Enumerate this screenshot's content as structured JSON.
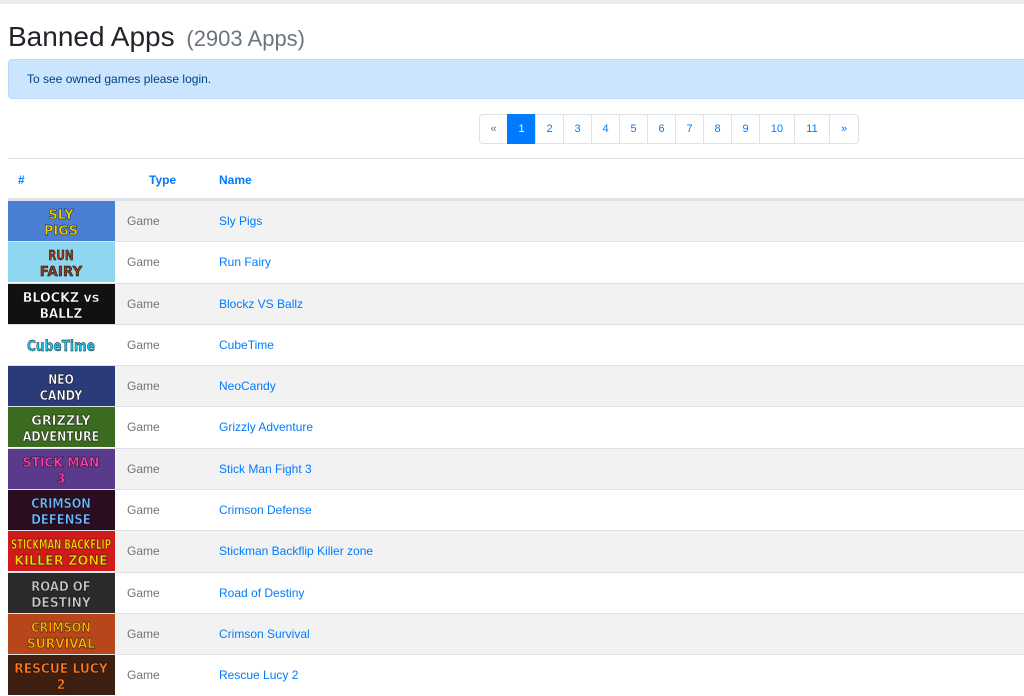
{
  "header": {
    "title": "Banned Apps",
    "count": "(2903 Apps)"
  },
  "alert": {
    "text": "To see owned games please login."
  },
  "pagination": {
    "prev": "«",
    "pages": [
      "1",
      "2",
      "3",
      "4",
      "5",
      "6",
      "7",
      "8",
      "9",
      "10",
      "11"
    ],
    "next": "»",
    "active": "1"
  },
  "table": {
    "columns": {
      "index": "#",
      "type": "Type",
      "name": "Name"
    },
    "rows": [
      {
        "type": "Game",
        "name": "Sly Pigs",
        "thumb_text": "SLY PIGS",
        "bg": "#4a7fd4",
        "fg": "#f5d000"
      },
      {
        "type": "Game",
        "name": "Run Fairy",
        "thumb_text": "RUN FAIRY",
        "bg": "#8fd6f0",
        "fg": "#8a3f1e"
      },
      {
        "type": "Game",
        "name": "Blockz VS Ballz",
        "thumb_text": "BLOCKZ vs BALLZ",
        "bg": "#111111",
        "fg": "#ffffff"
      },
      {
        "type": "Game",
        "name": "CubeTime",
        "thumb_text": "CubeTime",
        "bg": "#ffffff",
        "fg": "#1ec0e8"
      },
      {
        "type": "Game",
        "name": "NeoCandy",
        "thumb_text": "NEO CANDY",
        "bg": "#2b3a78",
        "fg": "#ffffff"
      },
      {
        "type": "Game",
        "name": "Grizzly Adventure",
        "thumb_text": "GRIZZLY ADVENTURE",
        "bg": "#3b6b1e",
        "fg": "#ffffff"
      },
      {
        "type": "Game",
        "name": "Stick Man Fight 3",
        "thumb_text": "STICK MAN 3",
        "bg": "#5a3a8a",
        "fg": "#ff3fb0"
      },
      {
        "type": "Game",
        "name": "Crimson Defense",
        "thumb_text": "CRIMSON DEFENSE",
        "bg": "#2a0d1e",
        "fg": "#6fb7ff"
      },
      {
        "type": "Game",
        "name": "Stickman Backflip Killer zone",
        "thumb_text": "STICKMAN BACKFLIP KILLER ZONE",
        "bg": "#d11b1b",
        "fg": "#ffd400"
      },
      {
        "type": "Game",
        "name": "Road of Destiny",
        "thumb_text": "ROAD OF DESTINY",
        "bg": "#2a2a2a",
        "fg": "#c8c8c8"
      },
      {
        "type": "Game",
        "name": "Crimson Survival",
        "thumb_text": "CRIMSON SURVIVAL",
        "bg": "#b8461b",
        "fg": "#ffb000"
      },
      {
        "type": "Game",
        "name": "Rescue Lucy 2",
        "thumb_text": "RESCUE LUCY 2",
        "bg": "#3d1f12",
        "fg": "#ff7a1e"
      }
    ]
  }
}
